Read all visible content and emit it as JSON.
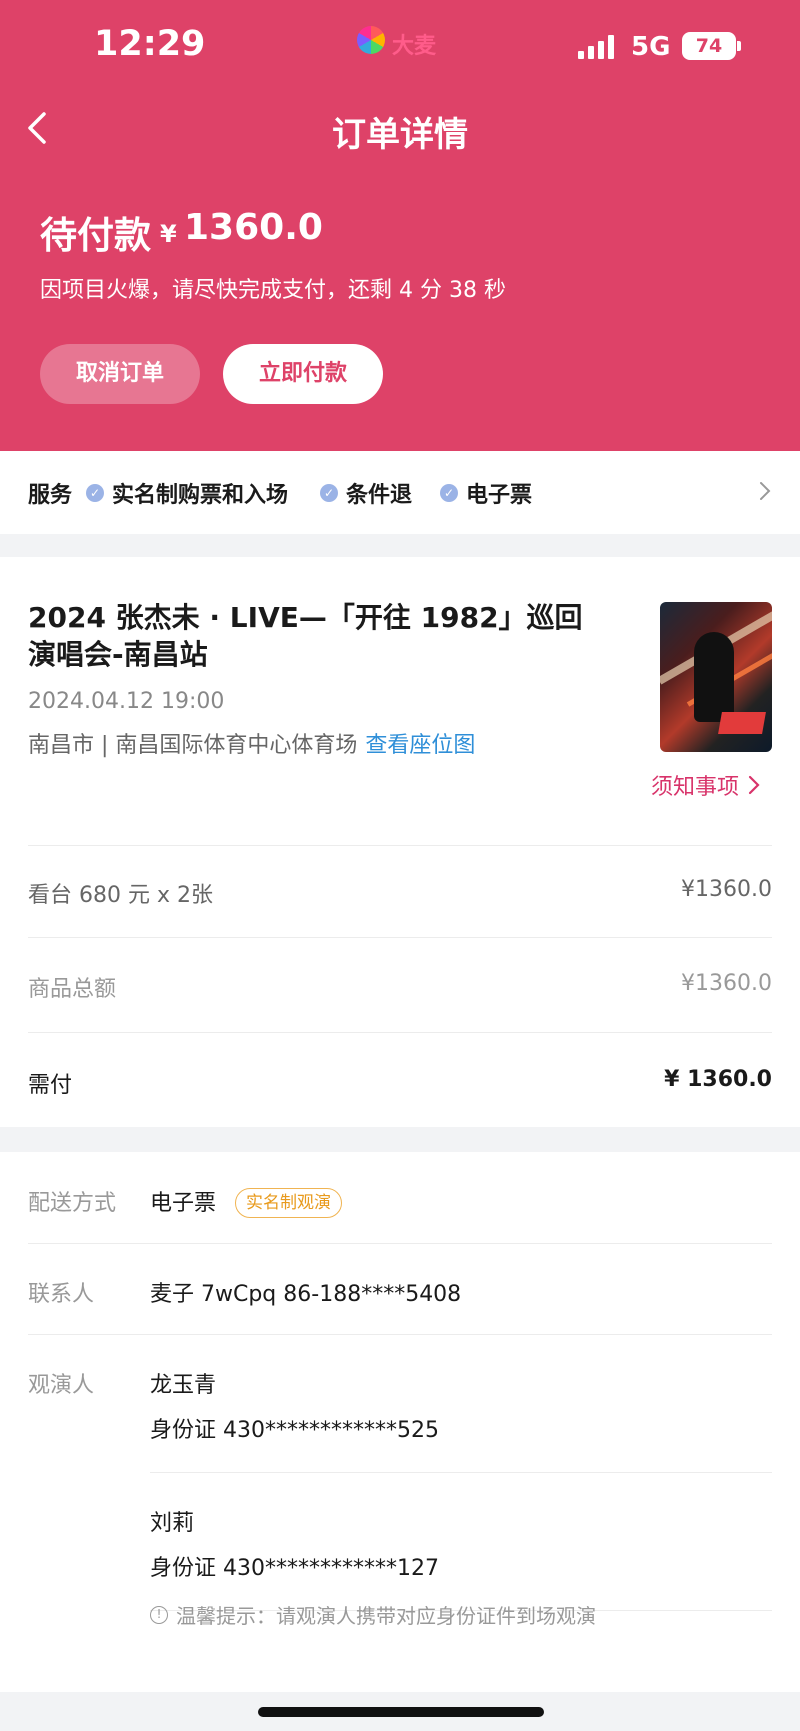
{
  "status_bar": {
    "time": "12:29",
    "app_name": "大麦",
    "network": "5G",
    "battery": "74"
  },
  "nav": {
    "title": "订单详情",
    "back_icon": "chevron-left-icon"
  },
  "payment": {
    "status": "待付款",
    "currency": "¥",
    "amount": "1360.0",
    "tip": "因项目火爆，请尽快完成支付，还剩 4 分 38 秒",
    "cancel_label": "取消订单",
    "pay_label": "立即付款"
  },
  "services": {
    "title": "服务",
    "items": [
      "实名制购票和入场",
      "条件退",
      "电子票"
    ]
  },
  "event": {
    "title": "2024 张杰未 · LIVE—「开往 1982」巡回演唱会-南昌站",
    "datetime": "2024.04.12 19:00",
    "venue": "南昌市 | 南昌国际体育中心体育场",
    "seat_map_label": "查看座位图",
    "notice_label": "须知事项"
  },
  "order": {
    "ticket_line": "看台 680 元 x 2张",
    "ticket_price": "¥1360.0",
    "subtotal_label": "商品总额",
    "subtotal_value": "¥1360.0",
    "total_label": "需付",
    "total_value": "¥ 1360.0"
  },
  "delivery": {
    "label": "配送方式",
    "value": "电子票",
    "tag": "实名制观演"
  },
  "contact": {
    "label": "联系人",
    "value": "麦子 7wCpq  86-188****5408"
  },
  "attendees": {
    "label": "观演人",
    "list": [
      {
        "name": "龙玉青",
        "id": "身份证  430************525"
      },
      {
        "name": "刘莉",
        "id": "身份证  430************127"
      }
    ],
    "warm_tip": "温馨提示：请观演人携带对应身份证件到场观演"
  },
  "colors": {
    "brand": "#de4268",
    "link": "#2f8fd8",
    "tag": "#e89a1c"
  }
}
